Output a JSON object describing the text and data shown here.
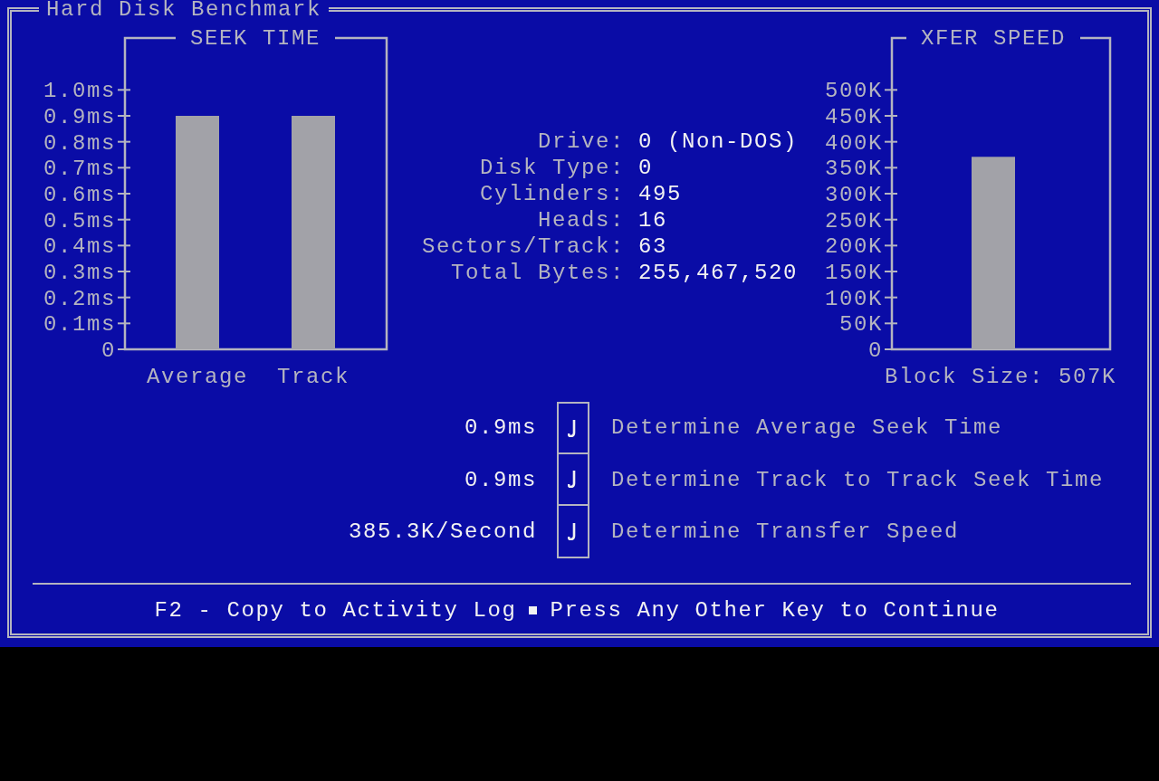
{
  "window": {
    "title": "Hard Disk Benchmark"
  },
  "seek_time": {
    "title": "SEEK TIME",
    "chart_data": {
      "type": "bar",
      "categories": [
        "Average",
        "Track"
      ],
      "values": [
        0.9,
        0.9
      ],
      "ylim": [
        0,
        1.2
      ],
      "yticks": [
        {
          "value": 0,
          "label": "0"
        },
        {
          "value": 0.1,
          "label": "0.1ms"
        },
        {
          "value": 0.2,
          "label": "0.2ms"
        },
        {
          "value": 0.3,
          "label": "0.3ms"
        },
        {
          "value": 0.4,
          "label": "0.4ms"
        },
        {
          "value": 0.5,
          "label": "0.5ms"
        },
        {
          "value": 0.6,
          "label": "0.6ms"
        },
        {
          "value": 0.7,
          "label": "0.7ms"
        },
        {
          "value": 0.8,
          "label": "0.8ms"
        },
        {
          "value": 0.9,
          "label": "0.9ms"
        },
        {
          "value": 1.0,
          "label": "1.0ms"
        }
      ]
    }
  },
  "drive_info": [
    {
      "label": "Drive:",
      "value": "0 (Non-DOS)"
    },
    {
      "label": "Disk Type:",
      "value": "0"
    },
    {
      "label": "Cylinders:",
      "value": "495"
    },
    {
      "label": "Heads:",
      "value": "16"
    },
    {
      "label": "Sectors/Track:",
      "value": "63"
    },
    {
      "label": "Total Bytes:",
      "value": "255,467,520"
    }
  ],
  "xfer_speed": {
    "title": "XFER SPEED",
    "chart_data": {
      "type": "bar",
      "xlabel": "Block Size: 507K",
      "values": [
        371
      ],
      "ylim": [
        0,
        600
      ],
      "yticks": [
        {
          "value": 0,
          "label": "0"
        },
        {
          "value": 50,
          "label": "50K"
        },
        {
          "value": 100,
          "label": "100K"
        },
        {
          "value": 150,
          "label": "150K"
        },
        {
          "value": 200,
          "label": "200K"
        },
        {
          "value": 250,
          "label": "250K"
        },
        {
          "value": 300,
          "label": "300K"
        },
        {
          "value": 350,
          "label": "350K"
        },
        {
          "value": 400,
          "label": "400K"
        },
        {
          "value": 450,
          "label": "450K"
        },
        {
          "value": 500,
          "label": "500K"
        }
      ]
    }
  },
  "tests": [
    {
      "result": "0.9ms",
      "checked": true,
      "label": "Determine Average Seek Time"
    },
    {
      "result": "0.9ms",
      "checked": true,
      "label": "Determine Track to Track Seek Time"
    },
    {
      "result": "385.3K/Second",
      "checked": true,
      "label": "Determine Transfer Speed"
    }
  ],
  "footer": [
    "F2 - Copy to Activity Log",
    "Press Any Other Key to Continue"
  ]
}
